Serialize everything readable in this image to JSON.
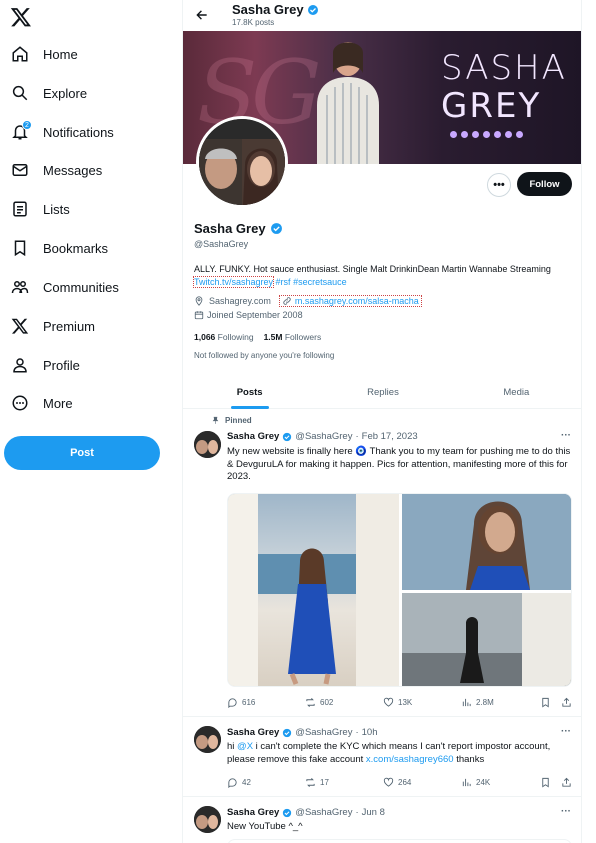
{
  "sidebar": {
    "items": [
      {
        "label": "Home",
        "icon": "home-icon"
      },
      {
        "label": "Explore",
        "icon": "search-icon"
      },
      {
        "label": "Notifications",
        "icon": "bell-icon",
        "badge": "2"
      },
      {
        "label": "Messages",
        "icon": "mail-icon"
      },
      {
        "label": "Lists",
        "icon": "list-icon"
      },
      {
        "label": "Bookmarks",
        "icon": "bookmark-icon"
      },
      {
        "label": "Communities",
        "icon": "people-icon"
      },
      {
        "label": "Premium",
        "icon": "x-logo-icon"
      },
      {
        "label": "Profile",
        "icon": "person-icon"
      },
      {
        "label": "More",
        "icon": "more-circle-icon"
      }
    ],
    "post_label": "Post"
  },
  "header": {
    "name": "Sasha Grey",
    "posts_count": "17.8K posts"
  },
  "banner": {
    "logo_line1": "SASHA",
    "logo_line2": "GREY"
  },
  "profile": {
    "name": "Sasha Grey",
    "handle": "@SashaGrey",
    "bio_text": "ALLY. FUNKY. Hot sauce enthusiast. Single Malt DrinkinDean Martin Wannabe Streaming",
    "bio_link": "Twitch.tv/sashagrey",
    "bio_tag1": "#rsf",
    "bio_tag2": "#secretsauce",
    "location": "Sashagrey.com",
    "website": "m.sashagrey.com/salsa-macha",
    "joined": "Joined September 2008",
    "following_count": "1,066",
    "following_label": "Following",
    "followers_count": "1.5M",
    "followers_label": "Followers",
    "not_followed": "Not followed by anyone you're following",
    "follow_label": "Follow",
    "more_label": "•••"
  },
  "tabs": [
    {
      "label": "Posts",
      "active": true
    },
    {
      "label": "Replies",
      "active": false
    },
    {
      "label": "Media",
      "active": false
    }
  ],
  "posts": [
    {
      "pinned_label": "Pinned",
      "name": "Sasha Grey",
      "handle": "@SashaGrey",
      "date": "Feb 17, 2023",
      "text": "My new website is finally here 🧿 Thank you to my team for pushing me to do this & DevguruLA for making it happen. Pics for attention, manifesting more of this for 2023.",
      "replies": "616",
      "reposts": "602",
      "likes": "13K",
      "views": "2.8M"
    },
    {
      "name": "Sasha Grey",
      "handle": "@SashaGrey",
      "date": "10h",
      "text_pre": "hi ",
      "mention": "@X",
      "text_mid": " i can't complete the KYC which means I can't report impostor account, please remove this fake account ",
      "link": "x.com/sashagrey660",
      "text_post": " thanks",
      "replies": "42",
      "reposts": "17",
      "likes": "264",
      "views": "24K"
    },
    {
      "name": "Sasha Grey",
      "handle": "@SashaGrey",
      "date": "Jun 8",
      "text": "New YouTube ^_^"
    }
  ],
  "colors": {
    "accent": "#1d9bf0",
    "text": "#0f1419",
    "muted": "#536471",
    "verified": "#1d9bf0"
  }
}
